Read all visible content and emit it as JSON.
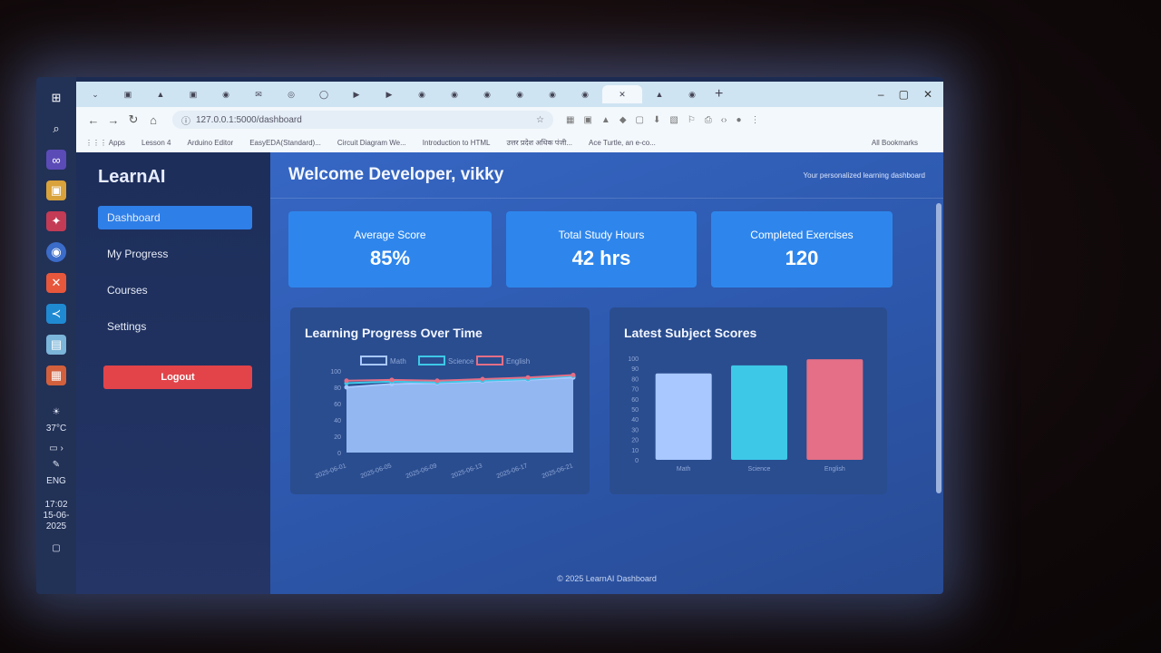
{
  "taskbar": {
    "weather": "37°C",
    "language": "ENG",
    "time": "17:02",
    "date": "15-06-2025"
  },
  "browser": {
    "url": "127.0.0.1:5000/dashboard",
    "apps_label": "Apps",
    "bookmarks": [
      "Lesson 4",
      "Arduino Editor",
      "EasyEDA(Standard)...",
      "Circuit Diagram We...",
      "Introduction to HTML",
      "उत्तर प्रदेश अधिक पंजी...",
      "Ace Turtle, an e-co...",
      "All Bookmarks"
    ]
  },
  "sidebar": {
    "logo": "LearnAI",
    "items": [
      {
        "label": "Dashboard"
      },
      {
        "label": "My Progress"
      },
      {
        "label": "Courses"
      },
      {
        "label": "Settings"
      }
    ],
    "logout_label": "Logout"
  },
  "header": {
    "welcome": "Welcome Developer, vikky",
    "subtitle": "Your personalized learning dashboard"
  },
  "stats": [
    {
      "label": "Average Score",
      "value": "85%"
    },
    {
      "label": "Total Study Hours",
      "value": "42 hrs"
    },
    {
      "label": "Completed Exercises",
      "value": "120"
    }
  ],
  "progress_chart": {
    "title": "Learning Progress Over Time",
    "legend": [
      "Math",
      "Science",
      "English"
    ]
  },
  "scores_chart": {
    "title": "Latest Subject Scores"
  },
  "footer": "© 2025 LearnAI Dashboard",
  "colors": {
    "accent": "#2f7fe8",
    "logout": "#e2444a",
    "math": "#a8c8ff",
    "science": "#3ec8e8",
    "english": "#e46f86"
  },
  "chart_data": [
    {
      "type": "line",
      "title": "Learning Progress Over Time",
      "x": [
        "2025-06-01",
        "2025-06-05",
        "2025-06-09",
        "2025-06-13",
        "2025-06-17",
        "2025-06-21"
      ],
      "series": [
        {
          "name": "Math",
          "values": [
            80,
            84,
            85,
            87,
            89,
            92
          ]
        },
        {
          "name": "Science",
          "values": [
            85,
            87,
            86,
            88,
            90,
            94
          ]
        },
        {
          "name": "English",
          "values": [
            88,
            89,
            88,
            90,
            92,
            95
          ]
        }
      ],
      "ylim": [
        0,
        100
      ],
      "yticks": [
        0,
        20,
        40,
        60,
        80,
        100
      ],
      "legend": "top"
    },
    {
      "type": "bar",
      "title": "Latest Subject Scores",
      "categories": [
        "Math",
        "Science",
        "English"
      ],
      "values": [
        85,
        93,
        99
      ],
      "ylim": [
        0,
        100
      ],
      "yticks": [
        0,
        10,
        20,
        30,
        40,
        50,
        60,
        70,
        80,
        90,
        100
      ]
    }
  ]
}
